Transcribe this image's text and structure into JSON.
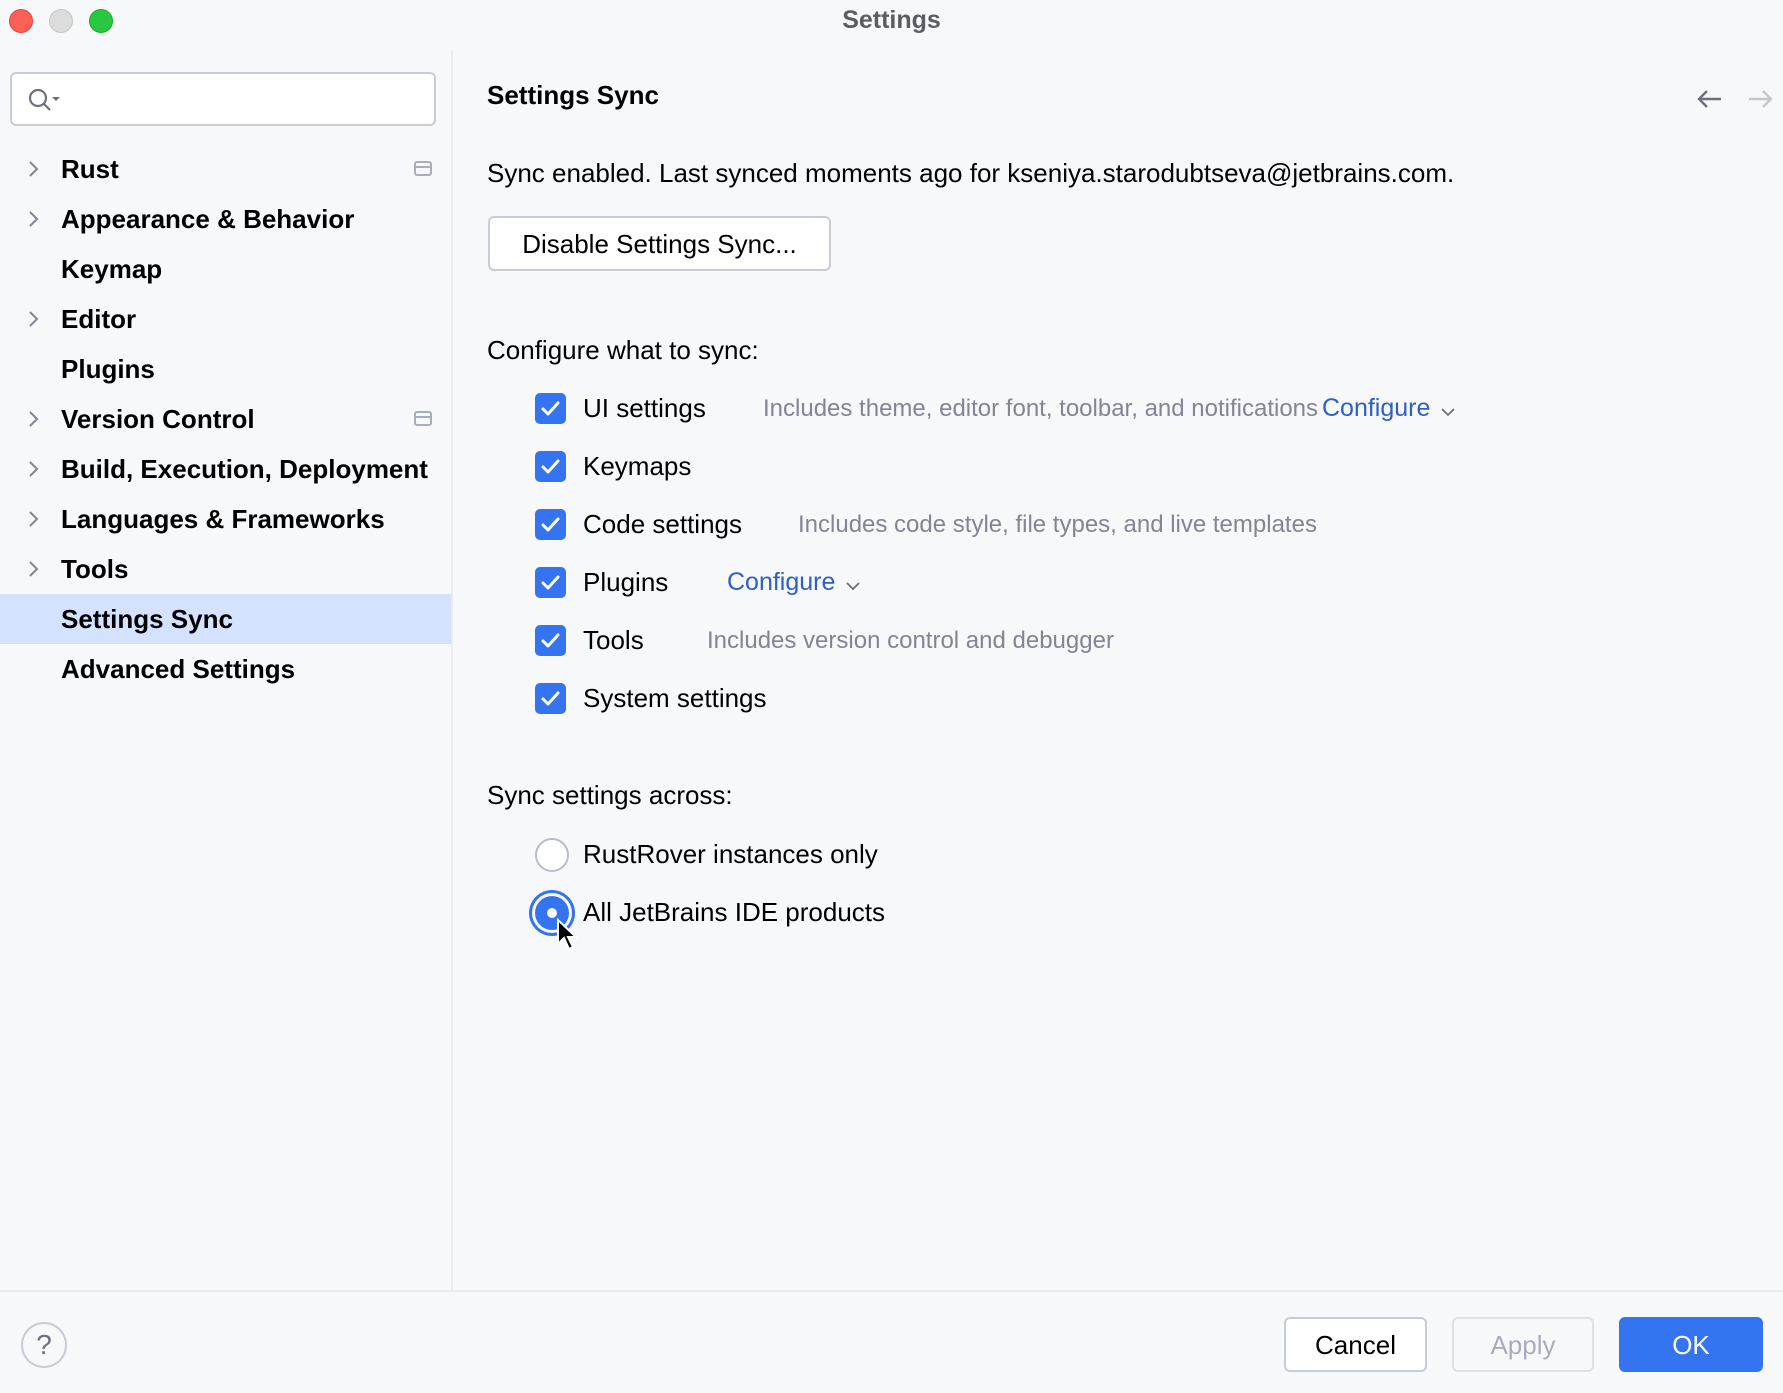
{
  "window": {
    "title": "Settings",
    "traffic_lights": [
      "close",
      "minimize",
      "maximize"
    ]
  },
  "sidebar": {
    "search": {
      "value": "",
      "placeholder": "",
      "icon": "search-icon"
    },
    "items": [
      {
        "label": "Rust",
        "expandable": true,
        "project_icon": true,
        "selected": false
      },
      {
        "label": "Appearance & Behavior",
        "expandable": true,
        "project_icon": false,
        "selected": false
      },
      {
        "label": "Keymap",
        "expandable": false,
        "project_icon": false,
        "selected": false
      },
      {
        "label": "Editor",
        "expandable": true,
        "project_icon": false,
        "selected": false
      },
      {
        "label": "Plugins",
        "expandable": false,
        "project_icon": false,
        "selected": false
      },
      {
        "label": "Version Control",
        "expandable": true,
        "project_icon": true,
        "selected": false
      },
      {
        "label": "Build, Execution, Deployment",
        "expandable": true,
        "project_icon": false,
        "selected": false
      },
      {
        "label": "Languages & Frameworks",
        "expandable": true,
        "project_icon": false,
        "selected": false
      },
      {
        "label": "Tools",
        "expandable": true,
        "project_icon": false,
        "selected": false
      },
      {
        "label": "Settings Sync",
        "expandable": false,
        "project_icon": false,
        "selected": true
      },
      {
        "label": "Advanced Settings",
        "expandable": false,
        "project_icon": false,
        "selected": false
      }
    ]
  },
  "main": {
    "title": "Settings Sync",
    "nav": {
      "back_enabled": true,
      "forward_enabled": false
    },
    "status": "Sync enabled. Last synced moments ago for kseniya.starodubtseva@jetbrains.com.",
    "disable_button": "Disable Settings Sync...",
    "configure_label": "Configure what to sync:",
    "sync_items": [
      {
        "label": "UI settings",
        "checked": true,
        "description": "Includes theme, editor font, toolbar, and notifications",
        "link": "Configure"
      },
      {
        "label": "Keymaps",
        "checked": true,
        "description": "",
        "link": ""
      },
      {
        "label": "Code settings",
        "checked": true,
        "description": "Includes code style, file types, and live templates",
        "link": ""
      },
      {
        "label": "Plugins",
        "checked": true,
        "description": "",
        "link": "Configure"
      },
      {
        "label": "Tools",
        "checked": true,
        "description": "Includes version control and debugger",
        "link": ""
      },
      {
        "label": "System settings",
        "checked": true,
        "description": "",
        "link": ""
      }
    ],
    "across_label": "Sync settings across:",
    "across_options": [
      {
        "label": "RustRover instances only",
        "selected": false
      },
      {
        "label": "All JetBrains IDE products",
        "selected": true
      }
    ]
  },
  "footer": {
    "help": "?",
    "cancel": "Cancel",
    "apply": "Apply",
    "apply_enabled": false,
    "ok": "OK"
  },
  "colors": {
    "accent": "#3574f0",
    "link": "#2f5fc4",
    "selection": "#d4e2ff",
    "background": "#f7f8fa",
    "muted_text": "#818594"
  }
}
